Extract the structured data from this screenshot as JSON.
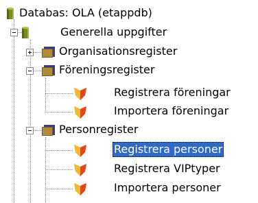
{
  "tree": {
    "root": {
      "label": "Databas: OLA (etappdb)",
      "icon": "database-icon"
    },
    "generella": {
      "label": "Generella uppgifter",
      "icon": "database-icon",
      "expanded": true
    },
    "organisationsregister": {
      "label": "Organisationsregister",
      "icon": "folder-icon",
      "expanded": false
    },
    "foreningsregister": {
      "label": "Föreningsregister",
      "icon": "folder-icon",
      "expanded": true
    },
    "registrera_foreningar": {
      "label": "Registrera föreningar",
      "icon": "form-icon"
    },
    "importera_foreningar": {
      "label": "Importera föreningar",
      "icon": "form-icon"
    },
    "personregister": {
      "label": "Personregister",
      "icon": "folder-icon",
      "expanded": true
    },
    "registrera_personer": {
      "label": "Registrera personer",
      "icon": "form-icon",
      "selected": true
    },
    "registrera_viptyper": {
      "label": "Registrera VIPtyper",
      "icon": "form-icon"
    },
    "importera_personer": {
      "label": "Importera personer",
      "icon": "form-icon"
    }
  },
  "colors": {
    "selection": "#316ac5",
    "folder": "#3b3b8f",
    "form_orange": "#f7a21b",
    "form_red": "#e03a1a",
    "database": "#6b7a1e"
  }
}
